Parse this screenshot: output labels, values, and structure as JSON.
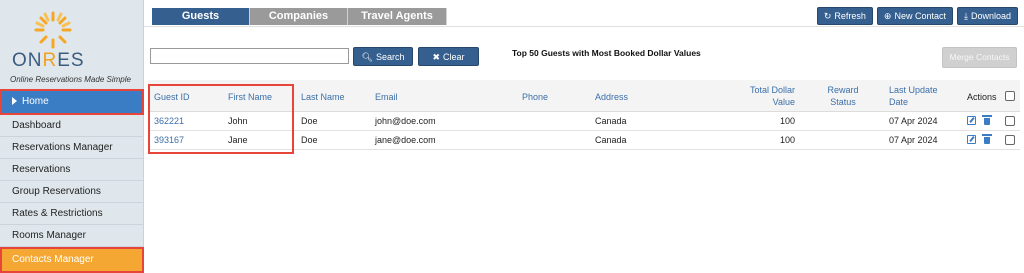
{
  "brand": {
    "logo_main": "ON",
    "logo_accent": "R",
    "logo_rest": "ES",
    "tagline": "Online Reservations Made Simple"
  },
  "sidebar": {
    "items": [
      {
        "label": "Home"
      },
      {
        "label": "Dashboard"
      },
      {
        "label": "Reservations Manager"
      },
      {
        "label": "Reservations"
      },
      {
        "label": "Group Reservations"
      },
      {
        "label": "Rates & Restrictions"
      },
      {
        "label": "Rooms Manager"
      },
      {
        "label": "Contacts Manager"
      }
    ]
  },
  "tabs": [
    {
      "label": "Guests"
    },
    {
      "label": "Companies"
    },
    {
      "label": "Travel Agents"
    }
  ],
  "toolbar": {
    "refresh": "Refresh",
    "new_contact": "New Contact",
    "download": "Download"
  },
  "search": {
    "value": "",
    "placeholder": "",
    "search_label": "Search",
    "clear_label": "Clear"
  },
  "report_title": "Top 50 Guests with Most Booked Dollar Values",
  "merge_label": "Merge Contacts",
  "table": {
    "headers": {
      "guest_id": "Guest ID",
      "first_name": "First Name",
      "last_name": "Last Name",
      "email": "Email",
      "phone": "Phone",
      "address": "Address",
      "total_line1": "Total Dollar",
      "total_line2": "Value",
      "reward_line1": "Reward",
      "reward_line2": "Status",
      "updated_line1": "Last Update",
      "updated_line2": "Date",
      "actions": "Actions"
    },
    "rows": [
      {
        "guest_id": "362221",
        "first_name": "John",
        "last_name": "Doe",
        "email": "john@doe.com",
        "phone": "",
        "address": "Canada",
        "total": "100",
        "reward": "",
        "updated": "07 Apr 2024"
      },
      {
        "guest_id": "393167",
        "first_name": "Jane",
        "last_name": "Doe",
        "email": "jane@doe.com",
        "phone": "",
        "address": "Canada",
        "total": "100",
        "reward": "",
        "updated": "07 Apr 2024"
      }
    ]
  },
  "colors": {
    "primary": "#355f8f",
    "home_bg": "#3b7dc4",
    "active_bg": "#f5a733",
    "highlight": "#e8453a",
    "link": "#3b6fa8"
  }
}
